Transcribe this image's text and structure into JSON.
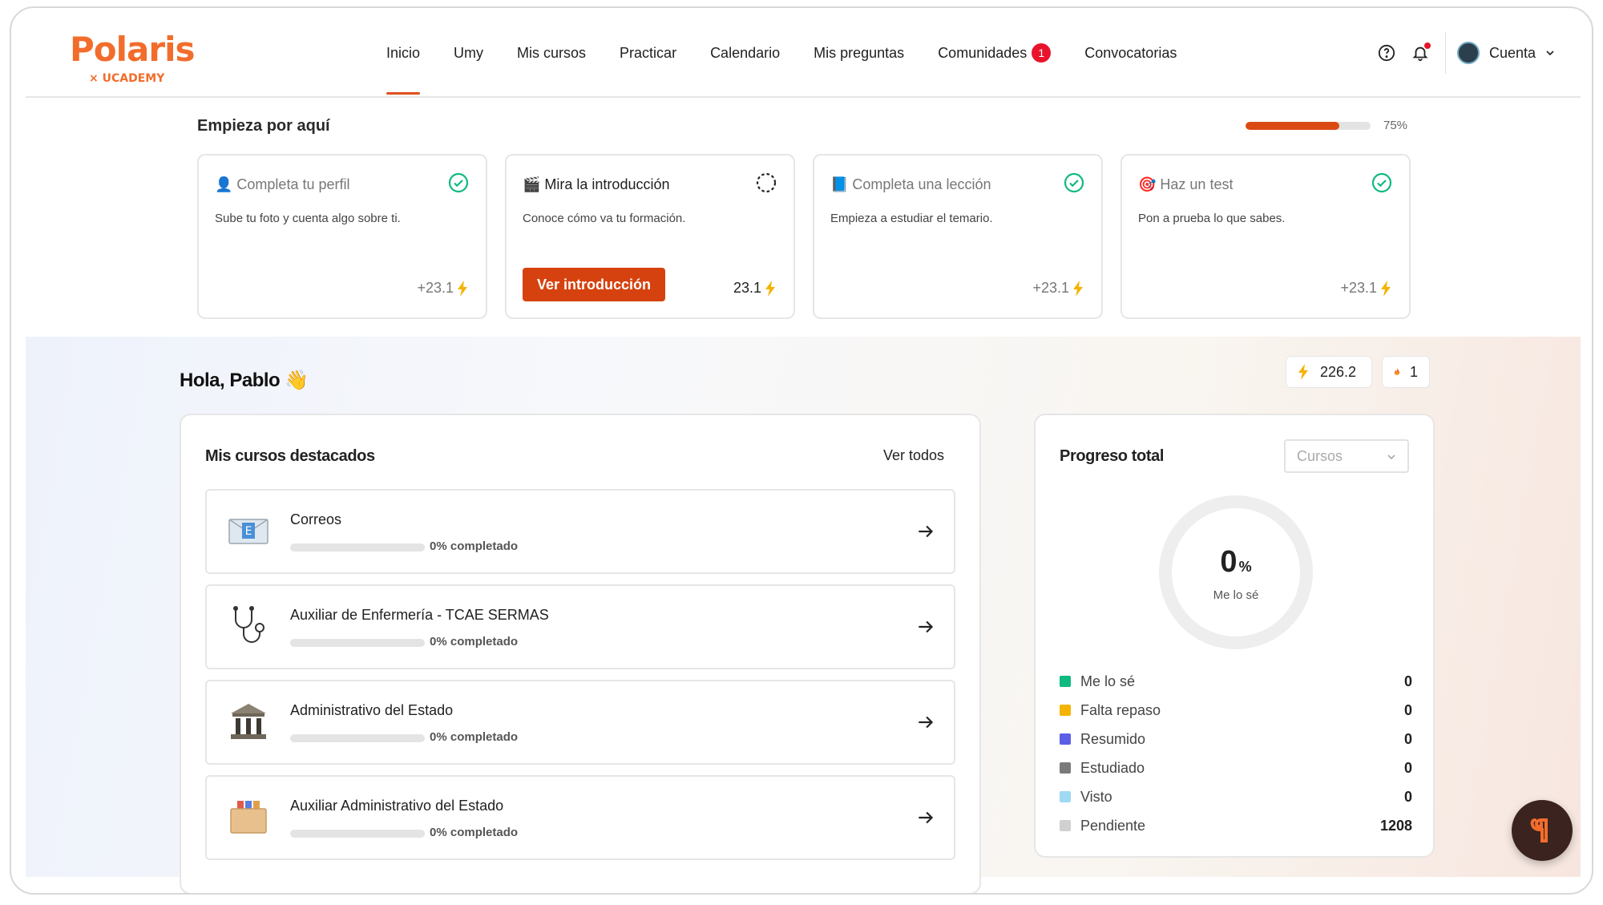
{
  "brand": {
    "name": "Polaris",
    "sub": "× UCADEMY",
    "accent": "#f26d2c"
  },
  "nav": {
    "items": [
      {
        "label": "Inicio",
        "active": true
      },
      {
        "label": "Umy"
      },
      {
        "label": "Mis cursos"
      },
      {
        "label": "Practicar"
      },
      {
        "label": "Calendario"
      },
      {
        "label": "Mis preguntas"
      },
      {
        "label": "Comunidades",
        "badge": "1"
      },
      {
        "label": "Convocatorias"
      }
    ],
    "help_icon": "help-circle-icon",
    "bell_icon": "bell-icon",
    "account_label": "Cuenta"
  },
  "onboarding": {
    "title": "Empieza por aquí",
    "progress": 0.75,
    "progress_label": "75%",
    "steps": [
      {
        "title": "👤 Completa tu perfil",
        "desc": "Sube tu foto y cuenta algo sobre ti.",
        "points": "+23.1",
        "done": true
      },
      {
        "title": "🎬 Mira la introducción",
        "desc": "Conoce cómo va tu formación.",
        "points": "23.1",
        "done": false,
        "cta": "Ver introducción"
      },
      {
        "title": "📘 Completa una lección",
        "desc": "Empieza a estudiar el temario.",
        "points": "+23.1",
        "done": true
      },
      {
        "title": "🎯 Haz un test",
        "desc": "Pon a prueba lo que sabes.",
        "points": "+23.1",
        "done": true
      }
    ]
  },
  "dashboard": {
    "greeting": "Hola, Pablo 👋",
    "energy": "226.2",
    "streak": "1",
    "courses_panel": {
      "title": "Mis cursos destacados",
      "view_all": "Ver todos",
      "courses": [
        {
          "name": "Correos",
          "progress": 0,
          "progress_label": "0% completado",
          "icon": "envelope-icon"
        },
        {
          "name": "Auxiliar de Enfermería - TCAE SERMAS",
          "progress": 0,
          "progress_label": "0% completado",
          "icon": "stethoscope-icon"
        },
        {
          "name": "Administrativo del Estado",
          "progress": 0,
          "progress_label": "0% completado",
          "icon": "building-icon"
        },
        {
          "name": "Auxiliar Administrativo del Estado",
          "progress": 0,
          "progress_label": "0% completado",
          "icon": "file-box-icon"
        }
      ]
    },
    "progress_panel": {
      "title": "Progreso total",
      "select_value": "Cursos",
      "ring_value": "0",
      "ring_unit": "%",
      "ring_label": "Me lo sé",
      "legend": [
        {
          "label": "Me lo sé",
          "count": "0",
          "color": "#10b981"
        },
        {
          "label": "Falta repaso",
          "count": "0",
          "color": "#f5b301"
        },
        {
          "label": "Resumido",
          "count": "0",
          "color": "#5b5fe6"
        },
        {
          "label": "Estudiado",
          "count": "0",
          "color": "#7a7a7a"
        },
        {
          "label": "Visto",
          "count": "0",
          "color": "#9fd9f2"
        },
        {
          "label": "Pendiente",
          "count": "1208",
          "color": "#d0d0d0"
        }
      ]
    }
  },
  "colors": {
    "primary": "#d6420f",
    "check": "#10b981",
    "bolt": "#f5b301"
  }
}
